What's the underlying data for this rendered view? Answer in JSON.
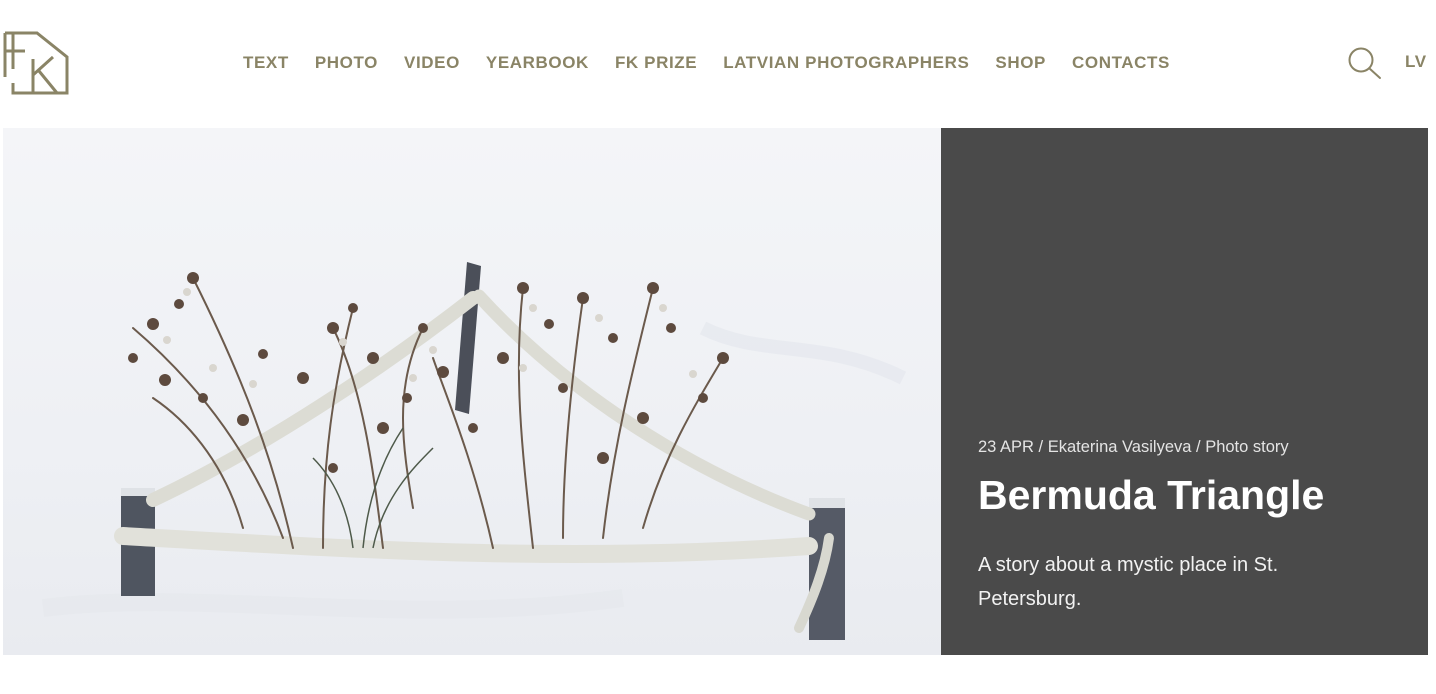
{
  "header": {
    "logo_icon": "fk-logo-icon",
    "logo_text": "FK",
    "nav": [
      {
        "label": "TEXT"
      },
      {
        "label": "PHOTO"
      },
      {
        "label": "VIDEO"
      },
      {
        "label": "YEARBOOK"
      },
      {
        "label": "FK PRIZE"
      },
      {
        "label": "LATVIAN PHOTOGRAPHERS"
      },
      {
        "label": "SHOP"
      },
      {
        "label": "CONTACTS"
      }
    ],
    "search_icon": "search-icon",
    "language": "LV"
  },
  "colors": {
    "nav_text": "#8a8466",
    "panel_background": "#4a4a4a",
    "panel_text": "#ffffff"
  },
  "hero": {
    "photo_icon": "snow-plants-photo",
    "date": "23 APR",
    "separator": " / ",
    "author": "Ekaterina Vasilyeva",
    "category": "Photo story",
    "title": "Bermuda Triangle",
    "description": "A story about a mystic place in St. Petersburg."
  }
}
